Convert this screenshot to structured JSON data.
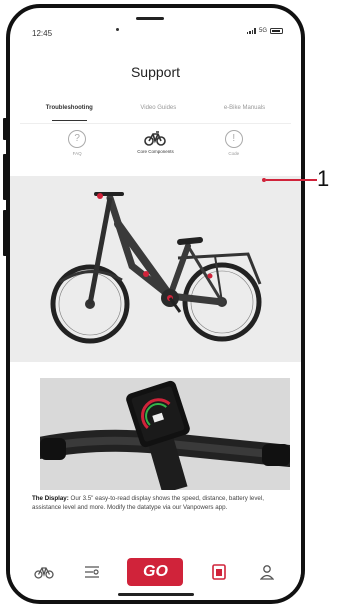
{
  "status": {
    "time": "12:45",
    "network": "5G"
  },
  "header": {
    "title": "Support"
  },
  "tabs": [
    {
      "label": "Troubleshooting",
      "active": true
    },
    {
      "label": "Video Guides",
      "active": false
    },
    {
      "label": "e-Bike Manuals",
      "active": false
    }
  ],
  "subnav": [
    {
      "label": "FAQ",
      "icon": "question-icon",
      "glyph": "?"
    },
    {
      "label": "Core Components",
      "icon": "bike-icon",
      "glyph": "ǿ"
    },
    {
      "label": "Code",
      "icon": "alert-icon",
      "glyph": "!"
    }
  ],
  "callout": {
    "number": "1",
    "color": "#d0233a"
  },
  "description": {
    "title": "The Display:",
    "body": "Our 3.5\" easy-to-read display shows the speed, distance, battery level, assistance level and more. Modify the datatype via our Vanpowers app."
  },
  "bottom_nav": {
    "go_label": "GO",
    "items": [
      "bike-icon",
      "list-icon",
      "go-button",
      "manual-icon",
      "profile-icon"
    ]
  },
  "colors": {
    "accent": "#d0233a",
    "hero_bg": "#ececec"
  }
}
